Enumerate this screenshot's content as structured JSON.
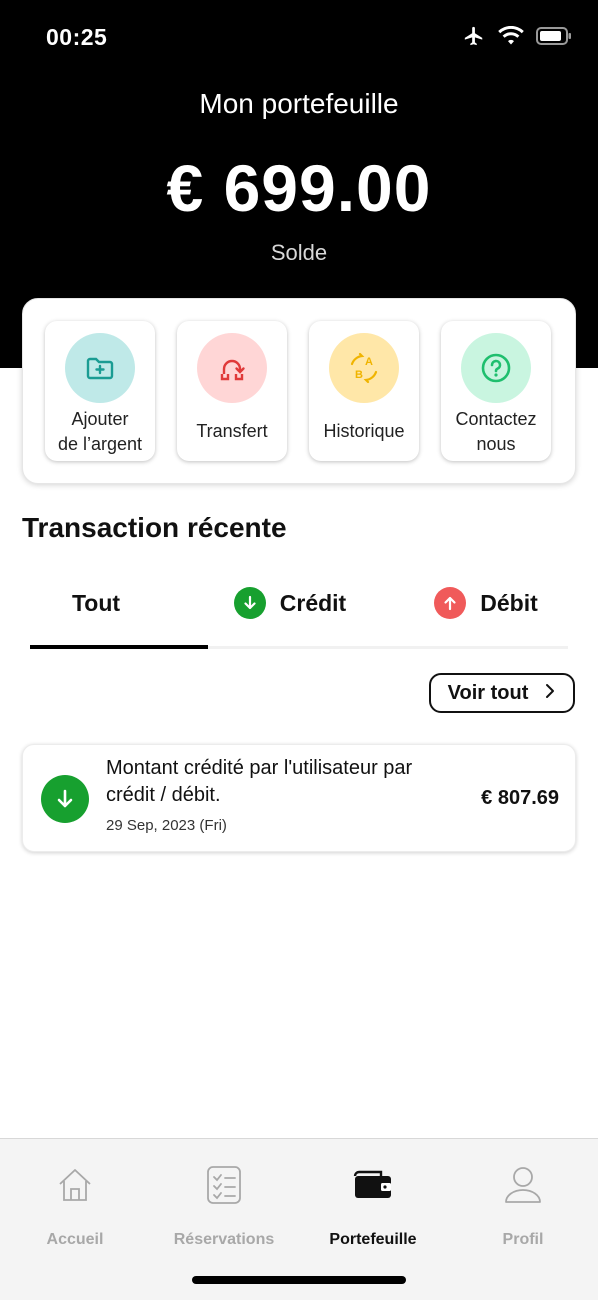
{
  "status_bar": {
    "time": "00:25"
  },
  "header": {
    "title": "Mon portefeuille",
    "balance": "€ 699.00",
    "balance_label": "Solde"
  },
  "actions": [
    {
      "line1": "Ajouter",
      "line2": "de l’argent",
      "icon": "add-folder-icon",
      "circle_color": "#bfe9e8",
      "icon_color": "#1a9c93"
    },
    {
      "line1": "Transfert",
      "icon": "transfer-icon",
      "circle_color": "#ffd6d6",
      "icon_color": "#e03a3a"
    },
    {
      "line1": "Historique",
      "icon": "history-ab-icon",
      "circle_color": "#ffe7a8",
      "icon_color": "#f0b400"
    },
    {
      "line1": "Contactez",
      "line2": "nous",
      "icon": "help-icon",
      "circle_color": "#c9f5e0",
      "icon_color": "#1fbf6e"
    }
  ],
  "section": {
    "title": "Transaction récente"
  },
  "tabs": [
    {
      "label": "Tout",
      "active": true
    },
    {
      "label": "Crédit",
      "icon": "arrow-down-icon",
      "color": "#17a02f"
    },
    {
      "label": "Débit",
      "icon": "arrow-up-icon",
      "color": "#f05a5a"
    }
  ],
  "view_all": {
    "label": "Voir tout"
  },
  "transactions": [
    {
      "description": "Montant crédité par l'utilisateur par crédit / débit.",
      "date": "29 Sep, 2023 (Fri)",
      "amount": "€ 807.69",
      "type": "credit"
    }
  ],
  "bottom_nav": [
    {
      "label": "Accueil",
      "icon": "home-icon",
      "active": false
    },
    {
      "label": "Réservations",
      "icon": "checklist-icon",
      "active": false
    },
    {
      "label": "Portefeuille",
      "icon": "wallet-icon",
      "active": true
    },
    {
      "label": "Profil",
      "icon": "profile-icon",
      "active": false
    }
  ],
  "colors": {
    "header_bg": "#000000",
    "credit": "#17a02f",
    "debit": "#f05a5a"
  }
}
